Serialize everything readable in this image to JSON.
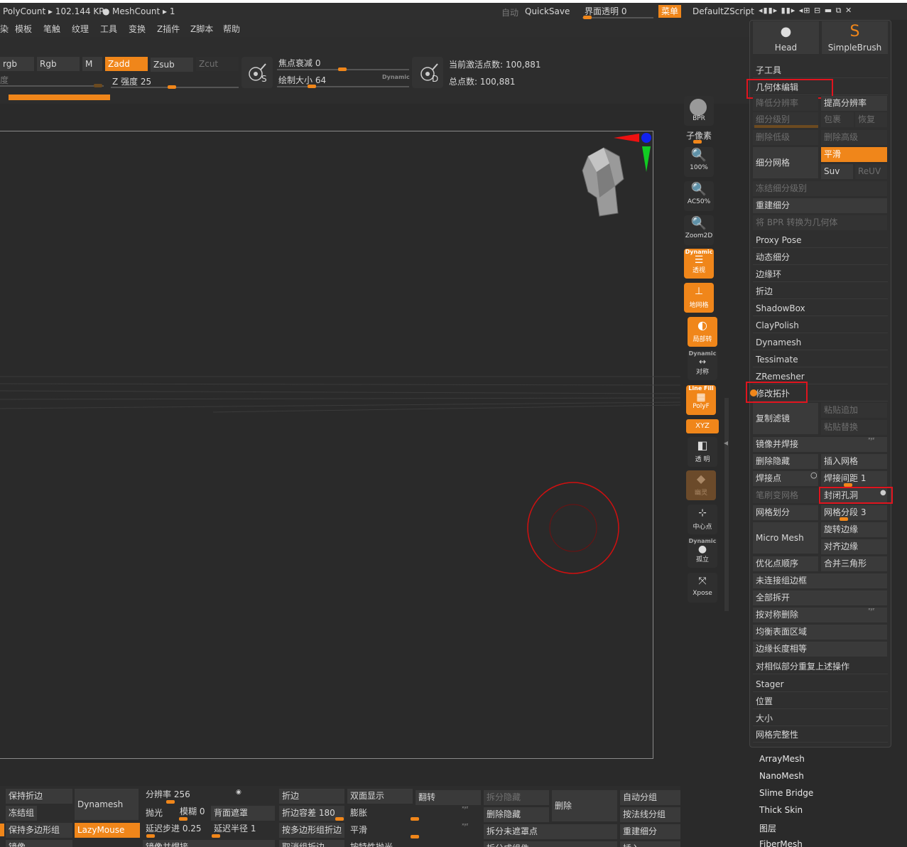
{
  "status": {
    "polycount": "PolyCount ▸ 102.144 KP",
    "meshcount": "MeshCount ▸ 1",
    "auto": "自动",
    "quicksave": "QuickSave",
    "ui_transparency": "界面透明 0",
    "menu_btn": "菜单",
    "script": "DefaultZScript"
  },
  "menus": [
    "染",
    "模板",
    "笔触",
    "纹理",
    "工具",
    "变换",
    "Z插件",
    "Z脚本",
    "帮助"
  ],
  "toolbar": {
    "mrgb": "rgb",
    "rgb": "Rgb",
    "m": "M",
    "zadd": "Zadd",
    "zsub": "Zsub",
    "zcut": "Zcut",
    "intensity_label": "度",
    "z_intensity": "Z 强度 25",
    "focal_shift": "焦点衰减 0",
    "draw_size": "绘制大小 64",
    "dynamic": "Dynamic",
    "active_points": "当前激活点数: 100,881",
    "total_points": "总点数: 100,881",
    "s_label": "S",
    "d_label": "D"
  },
  "shelf": {
    "bpr": "BPR",
    "subpixel": "子像素",
    "zoom100": "100%",
    "ac50": "AC50%",
    "zoom2d": "Zoom2D",
    "persp_dyn": "Dynamic",
    "persp": "透视",
    "floor": "地网格",
    "local": "局部转",
    "sym_dyn": "Dynamic",
    "sym": "对称",
    "linefill": "Line Fill",
    "polyf": "PolyF",
    "xyz": "XYZ",
    "transp": "透 明",
    "ghost": "幽灵",
    "center": "中心点",
    "solo_dyn": "Dynamic",
    "solo": "孤立",
    "xpose": "Xpose"
  },
  "panel": {
    "head": "Head",
    "simplebrush": "SimpleBrush",
    "subtool": "子工具",
    "geometry": "几何体编辑",
    "lower_res": "降低分辨率",
    "higher_res": "提高分辨率",
    "sdiv": "细分级别",
    "cage": "包裹",
    "restore": "恢复",
    "del_lower": "删除低级",
    "del_higher": "删除高级",
    "divide": "细分网格",
    "smooth": "平滑",
    "suv": "Suv",
    "reuv": "ReUV",
    "freeze": "冻结细分级别",
    "reconstruct": "重建细分",
    "bpr_geo": "将 BPR 转换为几何体",
    "items": [
      "Proxy Pose",
      "动态细分",
      "边缘环",
      "折边",
      "ShadowBox",
      "ClayPolish",
      "Dynamesh",
      "Tessimate",
      "ZRemesher"
    ],
    "modify_topo": "修改拓扑",
    "copy_filter": "复制滤镜",
    "paste_append": "粘贴追加",
    "paste_replace": "粘贴替换",
    "mirror_weld": "镜像并焊接",
    "del_hidden": "删除隐藏",
    "insert_mesh": "插入网格",
    "weld_points": "焊接点",
    "weld_dist": "焊接间距 1",
    "brush_mesh": "笔刷变网格",
    "close_holes": "封闭孔洞",
    "grid_divide": "网格划分",
    "grid_seg": "网格分段 3",
    "micro_mesh": "Micro Mesh",
    "spin_edge": "旋转边缘",
    "align_edge": "对齐边缘",
    "optimize": "优化点顺序",
    "merge_tris": "合并三角形",
    "unweld": "未连接组边框",
    "split_all": "全部拆开",
    "del_by_sym": "按对称删除",
    "equalize_surface": "均衡表面区域",
    "equalize_edge": "边缘长度相等",
    "repeat_similar": "对相似部分重复上述操作",
    "stager": "Stager",
    "position": "位置",
    "size": "大小",
    "mesh_integrity": "网格完整性"
  },
  "outside_items": [
    "ArrayMesh",
    "NanoMesh",
    "Slime Bridge",
    "Thick Skin",
    "图层",
    "FiberMesh"
  ],
  "bottom": {
    "keep_crease": "保持折边",
    "freeze_groups": "冻结组",
    "keep_polygroups": "保持多边形组",
    "dynamesh": "Dynamesh",
    "lazymouse": "LazyMouse",
    "mirror": "镜像",
    "resolution": "分辨率 256",
    "polish": "抛光",
    "blur": "模糊 0",
    "backface": "背面遮罩",
    "lazystep": "延迟步进 0.25",
    "lazyradius": "延迟半径 1",
    "mirror_weld": "镜像并焊接",
    "crease": "折边",
    "crease_tol": "折边容差 180",
    "crease_pg": "按多边形组折边",
    "uncrease_all": "取消组折边",
    "double": "双面显示",
    "inflate": "膨胀",
    "smooth": "平滑",
    "const_smooth": "按特性抛光",
    "flip": "翻转",
    "split_hidden": "拆分隐藏",
    "del_hidden": "删除隐藏",
    "split_unmasked": "拆分未遮罩点",
    "split_to_parts": "拆分成组件",
    "delete": "删除",
    "auto_groups": "自动分组",
    "groups_by_normal": "按法线分组",
    "reconstruct": "重建细分",
    "insert": "插入"
  }
}
